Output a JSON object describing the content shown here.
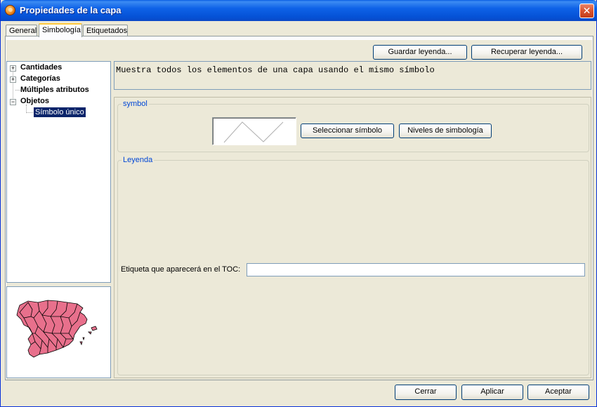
{
  "window": {
    "title": "Propiedades de la capa",
    "close_glyph": "✕"
  },
  "tabs": [
    {
      "label": "General",
      "active": false
    },
    {
      "label": "Simbología",
      "active": true
    },
    {
      "label": "Etiquetados",
      "active": false
    }
  ],
  "toolbar": {
    "save_legend": "Guardar leyenda...",
    "load_legend": "Recuperar leyenda..."
  },
  "tree": {
    "items": [
      {
        "label": "Cantidades",
        "expander": "+"
      },
      {
        "label": "Categorías",
        "expander": "+"
      },
      {
        "label": "Múltiples atributos",
        "expander": ""
      },
      {
        "label": "Objetos",
        "expander": "−"
      },
      {
        "label": "Símbolo único",
        "selected": true
      }
    ]
  },
  "description": "Muestra todos los elementos de una capa usando el mismo símbolo",
  "symbol_group": {
    "title": "symbol",
    "select_symbol": "Seleccionar símbolo",
    "symbology_levels": "Niveles de simbología"
  },
  "legend_group": {
    "title": "Leyenda",
    "toc_label": "Etiqueta que aparecerá en el TOC:",
    "toc_value": ""
  },
  "footer": {
    "close": "Cerrar",
    "apply": "Aplicar",
    "accept": "Aceptar"
  },
  "colors": {
    "map_fill": "#e8708c",
    "map_stroke": "#000000",
    "selection": "#0a246a",
    "group_title": "#0046d5"
  }
}
